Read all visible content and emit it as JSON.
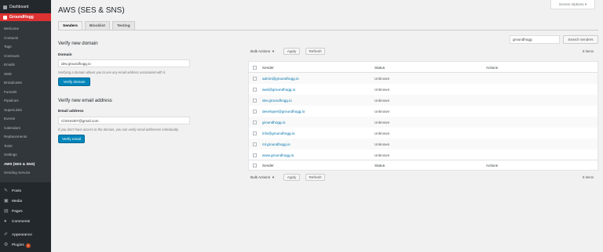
{
  "sidebar": {
    "dashboard": "Dashboard",
    "plugin_menu": "GroundHogg",
    "submenu": [
      "Welcome",
      "Contacts",
      "Tags",
      "Contracts",
      "Emails",
      "SMS",
      "Broadcasts",
      "Funnels",
      "Pipelines",
      "SuperLinks",
      "Events",
      "Calendars",
      "Replacements",
      "Tools",
      "Settings",
      "AWS (SES & SNS)",
      "Sending Service"
    ],
    "active_submenu_index": 15,
    "bottom": [
      {
        "label": "Posts",
        "icon": "pin-icon"
      },
      {
        "label": "Media",
        "icon": "media-icon"
      },
      {
        "label": "Pages",
        "icon": "pages-icon"
      },
      {
        "label": "Comments",
        "icon": "comments-icon"
      },
      {
        "label": "Appearance",
        "icon": "brush-icon"
      },
      {
        "label": "Plugins",
        "icon": "plugins-icon",
        "badge": "1"
      }
    ]
  },
  "header": {
    "title": "AWS (SES & SNS)",
    "screen_options": "Screen Options ▾",
    "tabs": [
      "Senders",
      "Blocklist",
      "Testing"
    ],
    "active_tab": 0
  },
  "domain_form": {
    "heading": "Verify new domain",
    "label": "Domain",
    "value": "dev.groundhogg.io",
    "description": "Verifying a domain allows you to use any email address associated with it.",
    "button": "Verify domain"
  },
  "email_form": {
    "heading": "Verify new email address",
    "label": "Email address",
    "value": "Chrismit07@gmail.com",
    "description": "If you don't have access to the domain, you can verify email addresses individually.",
    "button": "Verify email"
  },
  "table": {
    "search_value": "groundhogg",
    "search_button": "Search senders",
    "bulk_actions": "Bulk Actions",
    "apply": "Apply",
    "refresh": "Refresh",
    "items_count": "8 items",
    "columns": {
      "sender": "Sender",
      "status": "Status",
      "actions": "Actions"
    },
    "rows": [
      {
        "sender": "admin@groundhogg.io",
        "status": "Unknown"
      },
      {
        "sender": "aws@groundhogg.io",
        "status": "Unknown"
      },
      {
        "sender": "dev.groundhogg.io",
        "status": "Unknown"
      },
      {
        "sender": "developer@groundhogg.io",
        "status": "Unknown"
      },
      {
        "sender": "groundhogg.io",
        "status": "Unknown"
      },
      {
        "sender": "info@groundhogg.io",
        "status": "Unknown"
      },
      {
        "sender": "ml.groundhogg.io",
        "status": "Unknown"
      },
      {
        "sender": "www.groundhogg.io",
        "status": "Unknown"
      }
    ]
  },
  "colors": {
    "sidebar": "#23282d",
    "submenu": "#32373c",
    "accent": "#0085ba",
    "plugin_highlight": "#dc3232"
  }
}
